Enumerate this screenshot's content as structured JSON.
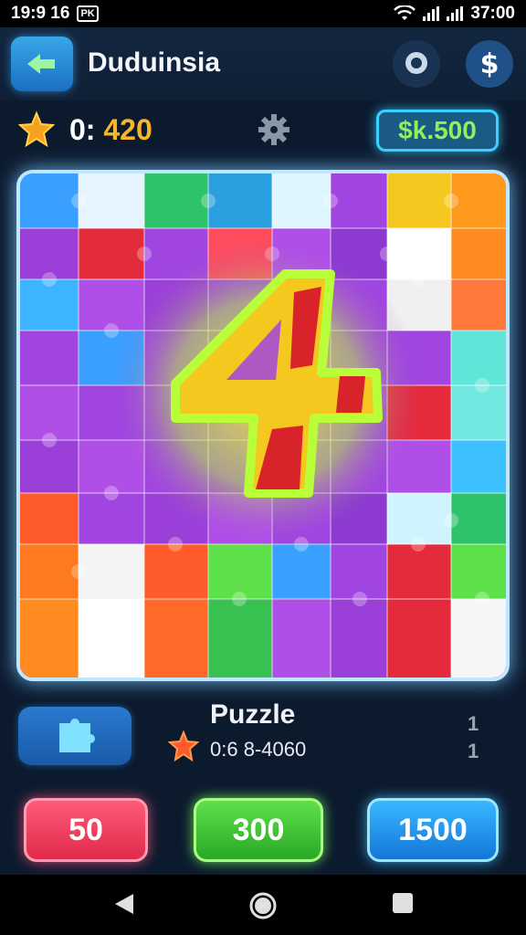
{
  "status_bar": {
    "time": "19:9 16",
    "notification_badge": "PK",
    "clock_right": "37:00",
    "icons": [
      "wifi-icon",
      "signal-icon",
      "signal-icon"
    ]
  },
  "header": {
    "title": "Duduinsia",
    "back_icon": "back-arrow-icon",
    "chat_icon": "chat-bubble-icon",
    "coin_symbol": "$"
  },
  "score": {
    "prefix": "0:",
    "value": "420",
    "cash": "$k.500"
  },
  "board": {
    "center_glyph": "4",
    "accent_colors": [
      "#a045e0",
      "#f5c81f",
      "#ff4c4c",
      "#3cc0ff",
      "#5ee04a",
      "#ffffff",
      "#ff8a1f",
      "#60e6d8"
    ]
  },
  "info": {
    "title": "Puzzle",
    "meta": "0:6 8-4060",
    "side_top": "1",
    "side_bottom": "1"
  },
  "actions": {
    "red_label": "50",
    "green_label": "300",
    "blue_label": "1500"
  },
  "nav": {
    "back": "back-triangle-icon",
    "home": "home-circle-icon",
    "recents": "recents-square-icon"
  }
}
